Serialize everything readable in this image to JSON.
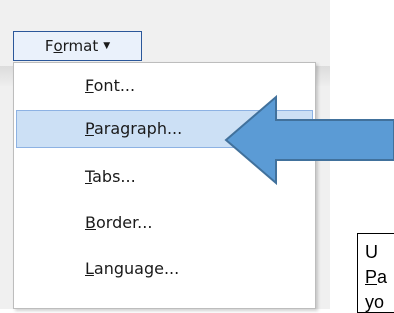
{
  "toolbar": {
    "format_button": {
      "label_pre": "F",
      "label_mnemonic": "o",
      "label_post": "rmat",
      "chevron_icon": "chevron-down-icon"
    }
  },
  "menu": {
    "items": [
      {
        "mnemonic": "F",
        "rest": "ont...",
        "selected": false
      },
      {
        "mnemonic": "P",
        "rest": "aragraph...",
        "selected": true
      },
      {
        "mnemonic": "T",
        "rest": "abs...",
        "selected": false
      },
      {
        "mnemonic": "B",
        "rest": "order...",
        "selected": false
      },
      {
        "mnemonic": "L",
        "rest": "anguage...",
        "selected": false
      }
    ]
  },
  "annotation": {
    "arrow_icon": "left-arrow-icon",
    "arrow_fill": "#5b9bd5",
    "arrow_stroke": "#41719c",
    "callout_line1": "U",
    "callout_line2_mnemonic": "P",
    "callout_line2_rest": "a",
    "callout_line3": "yo"
  },
  "colors": {
    "accent_border": "#2b579a",
    "selected_fill": "#cce0f5"
  }
}
